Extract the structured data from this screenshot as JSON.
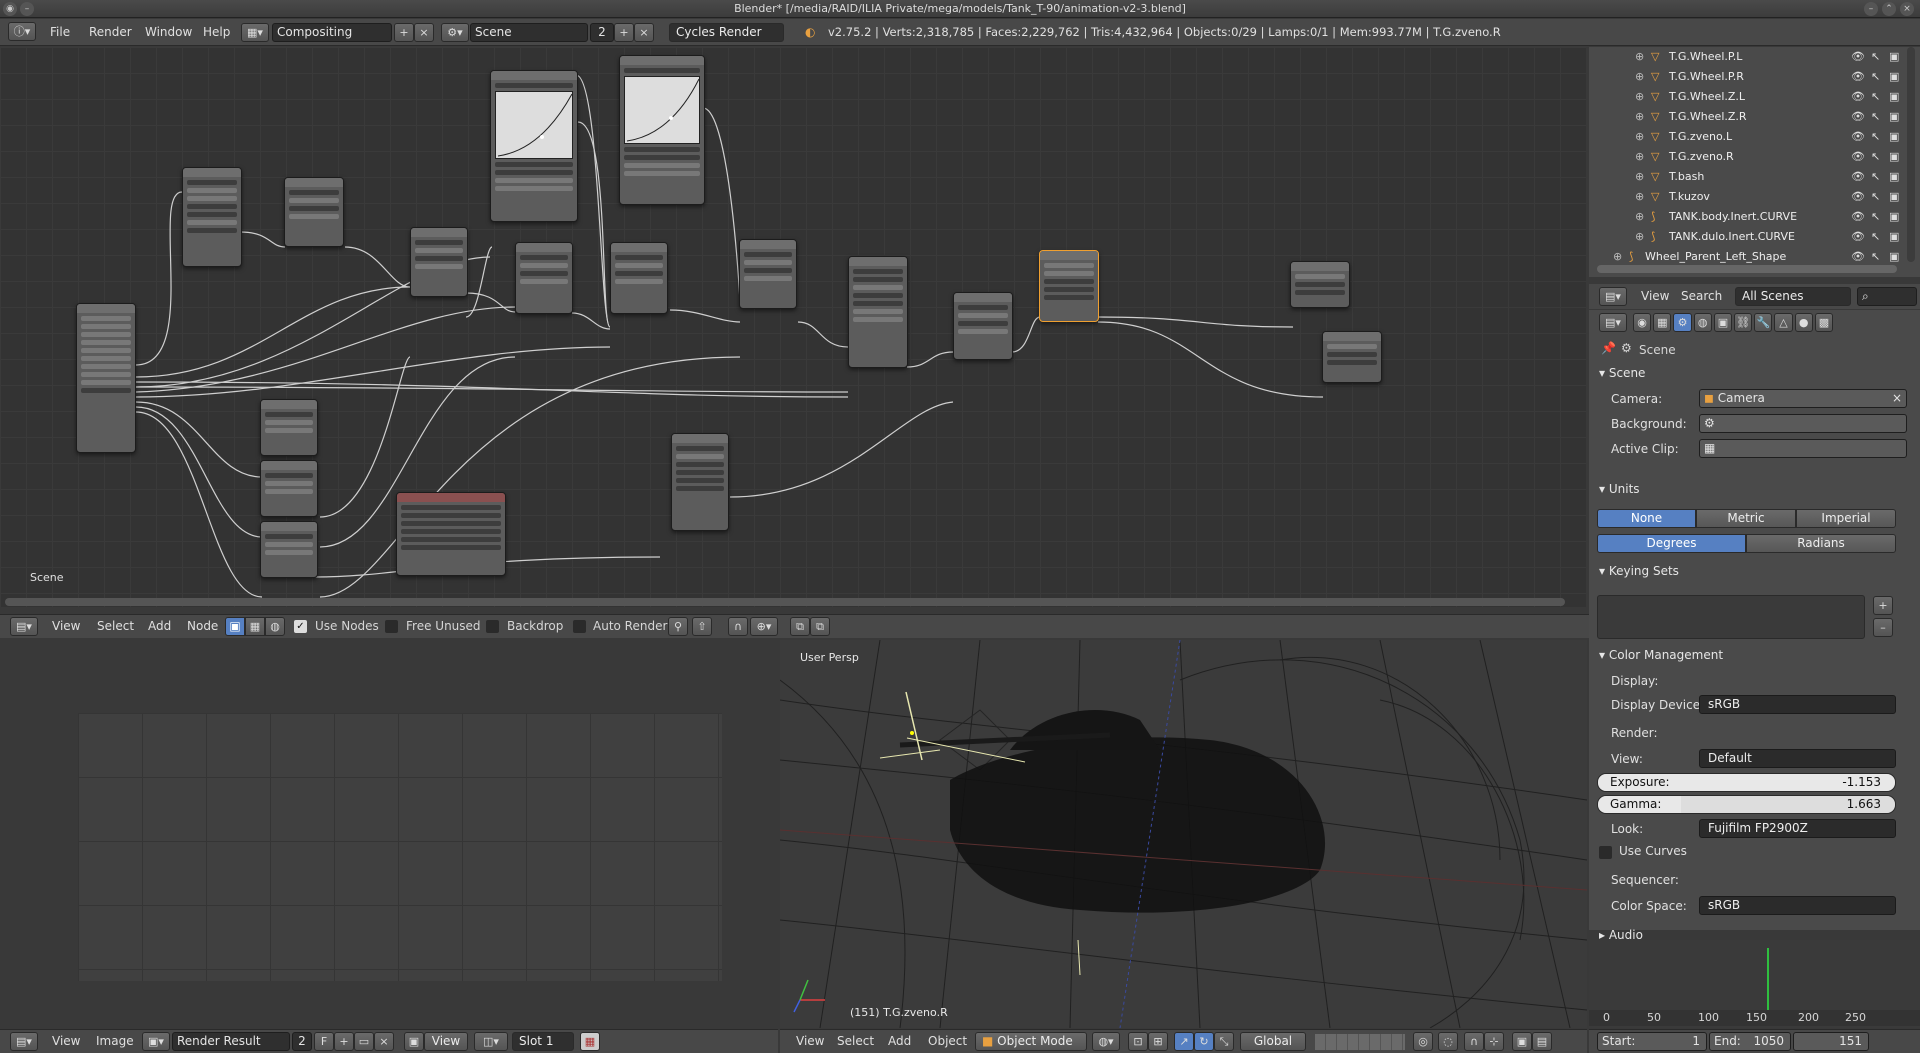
{
  "titlebar": {
    "title": "Blender* [/media/RAID/ILIA Private/mega/models/Tank_T-90/animation-v2-3.blend]"
  },
  "info_header": {
    "menus": [
      "File",
      "Render",
      "Window",
      "Help"
    ],
    "screen_layout": "Compositing",
    "scene": "Scene",
    "scene_users": "2",
    "render_engine": "Cycles Render",
    "stats": "v2.75.2 | Verts:2,318,785 | Faces:2,229,762 | Tris:4,432,964 | Objects:0/29 | Lamps:0/1 | Mem:993.77M | T.G.zveno.R"
  },
  "node_editor": {
    "area_label": "Scene",
    "header": {
      "menus": [
        "View",
        "Select",
        "Add",
        "Node"
      ],
      "use_nodes": "Use Nodes",
      "free_unused": "Free Unused",
      "backdrop": "Backdrop",
      "auto_render": "Auto Render"
    }
  },
  "image_editor": {
    "header": {
      "menus": [
        "View",
        "Image"
      ],
      "image_name": "Render Result",
      "users": "2",
      "f": "F",
      "view": "View",
      "slot": "Slot 1"
    }
  },
  "view3d": {
    "viewport_label": "User Persp",
    "object_label": "(151) T.G.zveno.R",
    "header": {
      "menus": [
        "View",
        "Select",
        "Add",
        "Object"
      ],
      "mode": "Object Mode",
      "orientation": "Global"
    }
  },
  "outliner": {
    "items": [
      "T.G.Wheel.P.L",
      "T.G.Wheel.P.R",
      "T.G.Wheel.Z.L",
      "T.G.Wheel.Z.R",
      "T.G.zveno.L",
      "T.G.zveno.R",
      "T.bash",
      "T.kuzov",
      "TANK.body.Inert.CURVE",
      "TANK.dulo.Inert.CURVE",
      "Wheel_Parent_Left_Shape"
    ],
    "header": {
      "view": "View",
      "search": "Search",
      "filter": "All Scenes"
    }
  },
  "properties": {
    "breadcrumb": "Scene",
    "scene_section": "Scene",
    "camera_label": "Camera:",
    "camera_value": "Camera",
    "background_label": "Background:",
    "active_clip_label": "Active Clip:",
    "units_section": "Units",
    "units_options": [
      "None",
      "Metric",
      "Imperial"
    ],
    "rotation_options": [
      "Degrees",
      "Radians"
    ],
    "keying_section": "Keying Sets",
    "color_mgmt_section": "Color Management",
    "display_label": "Display:",
    "display_device_label": "Display Device:",
    "display_device": "sRGB",
    "render_label": "Render:",
    "view_label": "View:",
    "view_value": "Default",
    "exposure_label": "Exposure:",
    "exposure_value": "-1.153",
    "gamma_label": "Gamma:",
    "gamma_value": "1.663",
    "look_label": "Look:",
    "look_value": "Fujifilm FP2900Z",
    "use_curves": "Use Curves",
    "sequencer_label": "Sequencer:",
    "color_space_label": "Color Space:",
    "color_space": "sRGB",
    "audio_section": "Audio"
  },
  "timeline": {
    "ticks": [
      "0",
      "50",
      "100",
      "150",
      "200",
      "250"
    ],
    "start": "Start:",
    "start_val": "1",
    "end": "End:",
    "end_val": "1050",
    "current": "151"
  },
  "colors": {
    "accent": "#5680c2",
    "selected_node": "#f0a030",
    "current_frame": "#2fbf3f"
  }
}
